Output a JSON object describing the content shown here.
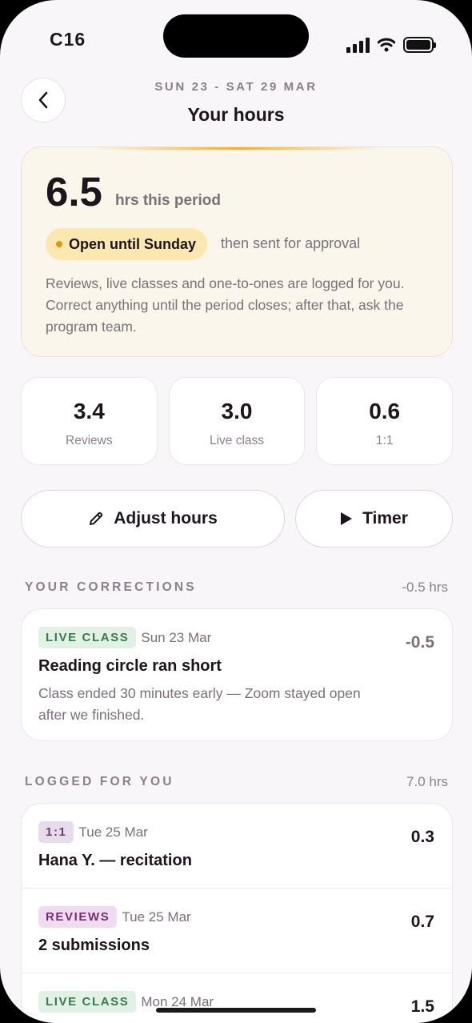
{
  "status_bar": {
    "time": "C16"
  },
  "header": {
    "date_range": "SUN 23 - SAT 29 MAR",
    "title": "Your hours"
  },
  "summary": {
    "total": "6.5",
    "unit": "hrs this period",
    "status_pill": "Open until Sunday",
    "status_after": "then sent for approval",
    "note": "Reviews, live classes and one-to-ones are logged for you. Correct anything until the period closes; after that, ask the program team."
  },
  "stats": [
    {
      "value": "3.4",
      "label": "Reviews"
    },
    {
      "value": "3.0",
      "label": "Live class"
    },
    {
      "value": "0.6",
      "label": "1:1"
    }
  ],
  "actions": {
    "adjust_label": "Adjust hours",
    "timer_label": "Timer"
  },
  "corrections": {
    "heading": "YOUR CORRECTIONS",
    "total": "-0.5 hrs",
    "items": [
      {
        "tag": "LIVE CLASS",
        "date": "Sun 23 Mar",
        "title": "Reading circle ran short",
        "note": "Class ended 30 minutes early — Zoom stayed open after we finished.",
        "value": "-0.5"
      }
    ]
  },
  "logged": {
    "heading": "LOGGED FOR YOU",
    "total": "7.0 hrs",
    "items": [
      {
        "tag": "1:1",
        "date": "Tue 25 Mar",
        "title": "Hana Y. — recitation",
        "value": "0.3"
      },
      {
        "tag": "REVIEWS",
        "date": "Tue 25 Mar",
        "title": "2 submissions",
        "value": "0.7"
      },
      {
        "tag": "LIVE CLASS",
        "date": "Mon 24 Mar",
        "title": "",
        "value": "1.5"
      }
    ]
  },
  "colors": {
    "accent_amber": "#f0b030",
    "live_class": "#3a7a4d",
    "reviews": "#7a2c76",
    "one_to_one": "#6a3e72"
  },
  "icons": [
    "back-chevron-icon",
    "pencil-icon",
    "play-icon",
    "cellular-signal-icon",
    "wifi-icon",
    "battery-icon"
  ]
}
